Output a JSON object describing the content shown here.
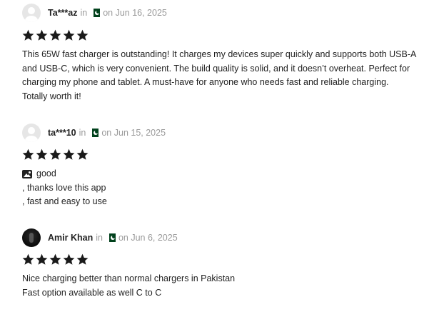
{
  "reviews": [
    {
      "author": "Ta***az",
      "in_text": "in",
      "country_flag_icon": "pakistan-flag-icon",
      "date": "on Jun 16, 2025",
      "rating": 5,
      "body_lines": [
        "This 65W fast charger is outstanding! It charges my devices super quickly and supports both USB-A",
        "and USB-C, which is very convenient. The build quality is solid, and it doesn’t overheat. Perfect for",
        "charging my phone and tablet. A must-have for anyone who needs fast and reliable charging.",
        "Totally worth it!"
      ]
    },
    {
      "author": "ta***10",
      "in_text": "in",
      "country_flag_icon": "pakistan-flag-icon",
      "date": "on Jun 15, 2025",
      "rating": 5,
      "has_image_icon": true,
      "body_lines": [
        "good",
        ", thanks love this app",
        ", fast and easy to use"
      ]
    },
    {
      "author": "Amir Khan",
      "in_text": "in",
      "country_flag_icon": "pakistan-flag-icon",
      "date": "on Jun 6, 2025",
      "rating": 5,
      "body_lines": [
        "Nice charging better than normal chargers in Pakistan",
        "Fast option available as well C to C"
      ]
    }
  ],
  "colors": {
    "star": "#1a1a1a",
    "meta": "#9a9a9a",
    "text": "#222222",
    "flag_green": "#01411c"
  }
}
